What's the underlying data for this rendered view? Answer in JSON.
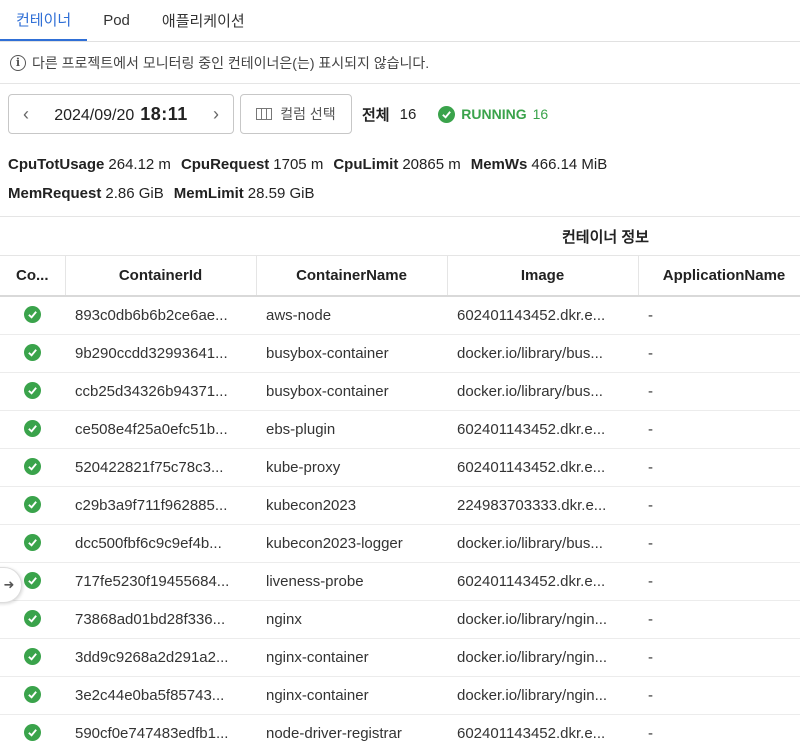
{
  "tabs": [
    {
      "label": "컨테이너",
      "active": true
    },
    {
      "label": "Pod",
      "active": false
    },
    {
      "label": "애플리케이션",
      "active": false
    }
  ],
  "info_text": "다른 프로젝트에서 모니터링 중인 컨테이너은(는) 표시되지 않습니다.",
  "toolbar": {
    "date": "2024/09/20",
    "time": "18:11",
    "column_select": "컬럼 선택",
    "total_label": "전체",
    "total_count": "16",
    "running_label": "RUNNING",
    "running_count": "16"
  },
  "metrics": {
    "cpu_tot_usage_label": "CpuTotUsage",
    "cpu_tot_usage": "264.12 m",
    "cpu_request_label": "CpuRequest",
    "cpu_request": "1705 m",
    "cpu_limit_label": "CpuLimit",
    "cpu_limit": "20865 m",
    "mem_ws_label": "MemWs",
    "mem_ws": "466.14 MiB",
    "mem_request_label": "MemRequest",
    "mem_request": "2.86 GiB",
    "mem_limit_label": "MemLimit",
    "mem_limit": "28.59 GiB"
  },
  "group_header": "컨테이너 정보",
  "columns": [
    "Co...",
    "ContainerId",
    "ContainerName",
    "Image",
    "ApplicationName"
  ],
  "rows": [
    {
      "id": "893c0db6b6b2ce6ae...",
      "name": "aws-node",
      "image": "602401143452.dkr.e...",
      "app": "-"
    },
    {
      "id": "9b290ccdd32993641...",
      "name": "busybox-container",
      "image": "docker.io/library/bus...",
      "app": "-"
    },
    {
      "id": "ccb25d34326b94371...",
      "name": "busybox-container",
      "image": "docker.io/library/bus...",
      "app": "-"
    },
    {
      "id": "ce508e4f25a0efc51b...",
      "name": "ebs-plugin",
      "image": "602401143452.dkr.e...",
      "app": "-"
    },
    {
      "id": "520422821f75c78c3...",
      "name": "kube-proxy",
      "image": "602401143452.dkr.e...",
      "app": "-"
    },
    {
      "id": "c29b3a9f711f962885...",
      "name": "kubecon2023",
      "image": "224983703333.dkr.e...",
      "app": "-"
    },
    {
      "id": "dcc500fbf6c9c9ef4b...",
      "name": "kubecon2023-logger",
      "image": "docker.io/library/bus...",
      "app": "-"
    },
    {
      "id": "717fe5230f19455684...",
      "name": "liveness-probe",
      "image": "602401143452.dkr.e...",
      "app": "-"
    },
    {
      "id": "73868ad01bd28f336...",
      "name": "nginx",
      "image": "docker.io/library/ngin...",
      "app": "-"
    },
    {
      "id": "3dd9c9268a2d291a2...",
      "name": "nginx-container",
      "image": "docker.io/library/ngin...",
      "app": "-"
    },
    {
      "id": "3e2c44e0ba5f85743...",
      "name": "nginx-container",
      "image": "docker.io/library/ngin...",
      "app": "-"
    },
    {
      "id": "590cf0e747483edfb1...",
      "name": "node-driver-registrar",
      "image": "602401143452.dkr.e...",
      "app": "-"
    }
  ]
}
